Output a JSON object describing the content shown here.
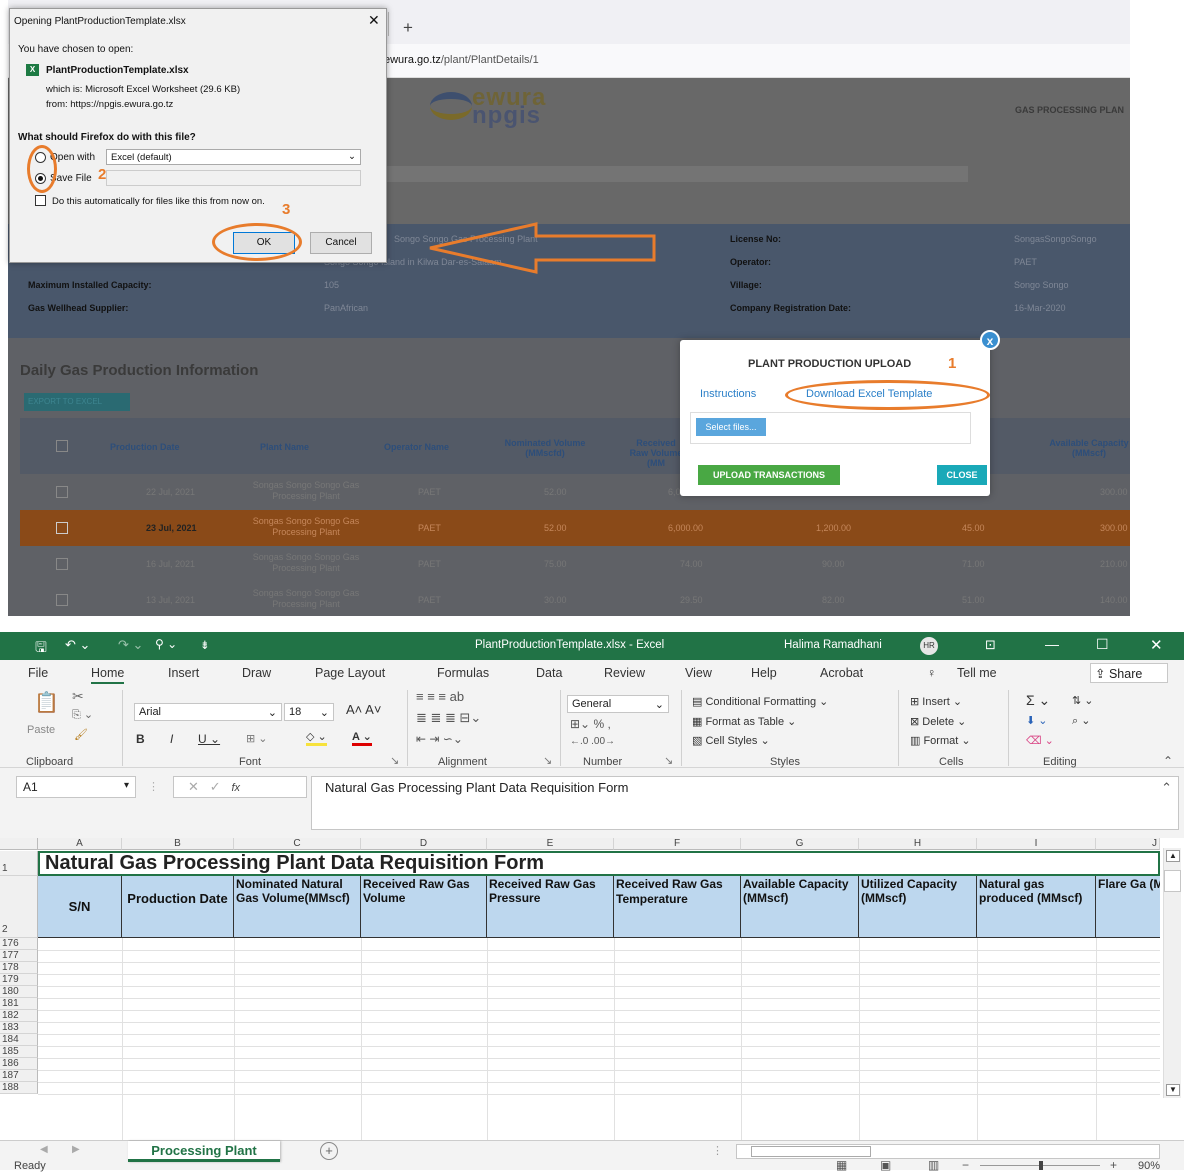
{
  "browser": {
    "url_prefix": "ewura.go.tz",
    "url_path": "/plant/PlantDetails/1",
    "new_tab": "+"
  },
  "site": {
    "logo_top": "ewura",
    "logo_bottom": "npgis",
    "header_right": "GAS PROCESSING PLAN",
    "info": {
      "name_value": "Songo Songo Gas Processing Plant",
      "location_value": "Songo Songo Island in Kilwa Dar-es-Salaam",
      "max_capacity_label": "Maximum Installed Capacity:",
      "max_capacity_value": "105",
      "supplier_label": "Gas Wellhead Supplier:",
      "supplier_value": "PanAfrican",
      "license_label": "License No:",
      "license_value": "SongasSongoSongo",
      "operator_label": "Operator:",
      "operator_value": "PAET",
      "village_label": "Village:",
      "village_value": "Songo Songo",
      "reg_date_label": "Company Registration Date:",
      "reg_date_value": "16-Mar-2020"
    },
    "section_title": "Daily Gas Production Information",
    "export_label": "EXPORT TO EXCEL",
    "table_headers": [
      "Production Date",
      "Plant Name",
      "Operator Name",
      "Nominated Volume (MMscfd)",
      "Received Raw Volume (MM",
      "Available Capacity (MMscf)"
    ],
    "rows": [
      {
        "date": "22 Jul, 2021",
        "plant": "Songas Songo Songo Gas Processing Plant",
        "operator": "PAET",
        "nominated": "52.00",
        "received": "6,000",
        "c3": "",
        "c4": "",
        "available": "300.00"
      },
      {
        "date": "23 Jul, 2021",
        "plant": "Songas Songo Songo Gas Processing Plant",
        "operator": "PAET",
        "nominated": "52.00",
        "received": "6,000.00",
        "c3": "1,200.00",
        "c4": "45.00",
        "available": "300.00"
      },
      {
        "date": "16 Jul, 2021",
        "plant": "Songas Songo Songo Gas Processing Plant",
        "operator": "PAET",
        "nominated": "75.00",
        "received": "74.00",
        "c3": "90.00",
        "c4": "71.00",
        "available": "210.00"
      },
      {
        "date": "13 Jul, 2021",
        "plant": "Songas Songo Songo Gas Processing Plant",
        "operator": "PAET",
        "nominated": "30.00",
        "received": "29.50",
        "c3": "82.00",
        "c4": "51.00",
        "available": "140.00"
      }
    ]
  },
  "dialog": {
    "title": "Opening PlantProductionTemplate.xlsx",
    "close": "✕",
    "chosen": "You have chosen to open:",
    "filename": "PlantProductionTemplate.xlsx",
    "which_is": "which is: Microsoft Excel Worksheet (29.6 KB)",
    "from": "from: https://npgis.ewura.go.tz",
    "question": "What should Firefox do with this file?",
    "open_with": "Open with",
    "open_with_app": "Excel (default)",
    "save_file": "Save File",
    "auto": "Do this automatically for files like this from now on.",
    "ok": "OK",
    "cancel": "Cancel",
    "step2": "2",
    "step3": "3"
  },
  "modal": {
    "title": "PLANT PRODUCTION UPLOAD",
    "step1": "1",
    "tab_instructions": "Instructions",
    "tab_download": "Download Excel Template",
    "select_files": "Select files...",
    "upload": "UPLOAD TRANSACTIONS",
    "close": "CLOSE",
    "x": "x"
  },
  "excel": {
    "title": "PlantProductionTemplate.xlsx  -  Excel",
    "user": "Halima Ramadhani",
    "user_initials": "HR",
    "menu": [
      "File",
      "Home",
      "Insert",
      "Draw",
      "Page Layout",
      "Formulas",
      "Data",
      "Review",
      "View",
      "Help",
      "Acrobat",
      "Tell me"
    ],
    "share": "Share",
    "ribbon": {
      "paste": "Paste",
      "clipboard": "Clipboard",
      "font_name": "Arial",
      "font_size": "18",
      "font": "Font",
      "alignment": "Alignment",
      "number_format": "General",
      "number": "Number",
      "cond_format": "Conditional Formatting",
      "format_table": "Format as Table",
      "cell_styles": "Cell Styles",
      "styles": "Styles",
      "insert": "Insert",
      "delete": "Delete",
      "format": "Format",
      "cells": "Cells",
      "editing": "Editing"
    },
    "name_box": "A1",
    "fx": "fx",
    "formula": "Natural Gas Processing Plant Data Requisition Form",
    "columns": [
      "A",
      "B",
      "C",
      "D",
      "E",
      "F",
      "G",
      "H",
      "I",
      "J"
    ],
    "sheet_title": "Natural Gas Processing Plant Data Requisition Form",
    "headers": [
      "S/N",
      "Production Date",
      "Nominated Natural Gas Volume(MMscf)",
      "Received Raw Gas Volume",
      "Received Raw Gas Pressure",
      "Received Raw Gas Temperature",
      "Available Capacity (MMscf)",
      "Utilized Capacity (MMscf)",
      "Natural gas produced (MMscf)",
      "Flare Ga (MMscf)"
    ],
    "row_numbers": [
      "1",
      "2",
      "176",
      "177",
      "178",
      "179",
      "180",
      "181",
      "182",
      "183",
      "184",
      "185",
      "186",
      "187",
      "188"
    ],
    "sheet_tab": "Processing Plant",
    "status": "Ready",
    "zoom": "90%"
  }
}
